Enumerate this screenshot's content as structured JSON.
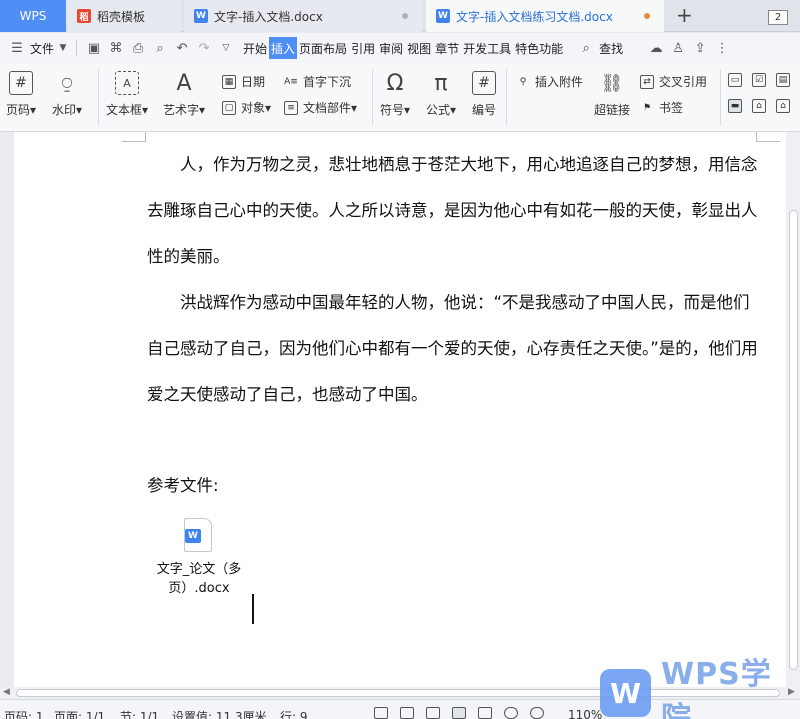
{
  "tabs": [
    {
      "label": "WPS"
    },
    {
      "label": "稻壳模板",
      "icon": "docer-icon"
    },
    {
      "label": "文字-插入文档.docx",
      "icon": "word-doc-icon"
    },
    {
      "label": "文字-插入文档练习文档.docx",
      "icon": "word-doc-icon"
    }
  ],
  "tab_count": "2",
  "menu": {
    "file": "文件",
    "items": [
      "开始",
      "插入",
      "页面布局",
      "引用",
      "审阅",
      "视图",
      "章节",
      "开发工具",
      "特色功能"
    ],
    "active": "插入",
    "search": "查找"
  },
  "ribbon": {
    "page_number": "页码",
    "watermark": "水印",
    "text_box": "文本框",
    "word_art": "艺术字",
    "date": "日期",
    "object": "对象",
    "drop_cap": "首字下沉",
    "doc_parts": "文档部件",
    "symbol": "符号",
    "formula": "公式",
    "numbering": "编号",
    "insert_attachment": "插入附件",
    "hyperlink": "超链接",
    "cross_reference": "交叉引用",
    "bookmark": "书签"
  },
  "document": {
    "para1": "人，作为万物之灵，悲壮地栖息于苍茫大地下，用心地追逐自己的梦想，用信念去雕琢自己心中的天使。人之所以诗意，是因为他心中有如花一般的天使，彰显出人性的美丽。",
    "para2": "洪战辉作为感动中国最年轻的人物，他说：“不是我感动了中国人民，而是他们自己感动了自己，因为他们心中都有一个爱的天使，心存责任之天使。”是的，他们用爱之天使感动了自己，也感动了中国。",
    "ref_title": "参考文件:",
    "attachment_name": "文字_论文（多页）.docx"
  },
  "status": {
    "page": "页码: 1",
    "pages": "页面: 1/1",
    "section": "节: 1/1",
    "setting": "设置值: 11.3厘米",
    "line": "行: 9",
    "zoom": "110%"
  },
  "watermark": {
    "logo": "W",
    "text": "WPS学院"
  },
  "colors": {
    "accent": "#4f8ef5",
    "word_icon": "#3f83ee",
    "unsaved_dot": "#f08a30"
  }
}
